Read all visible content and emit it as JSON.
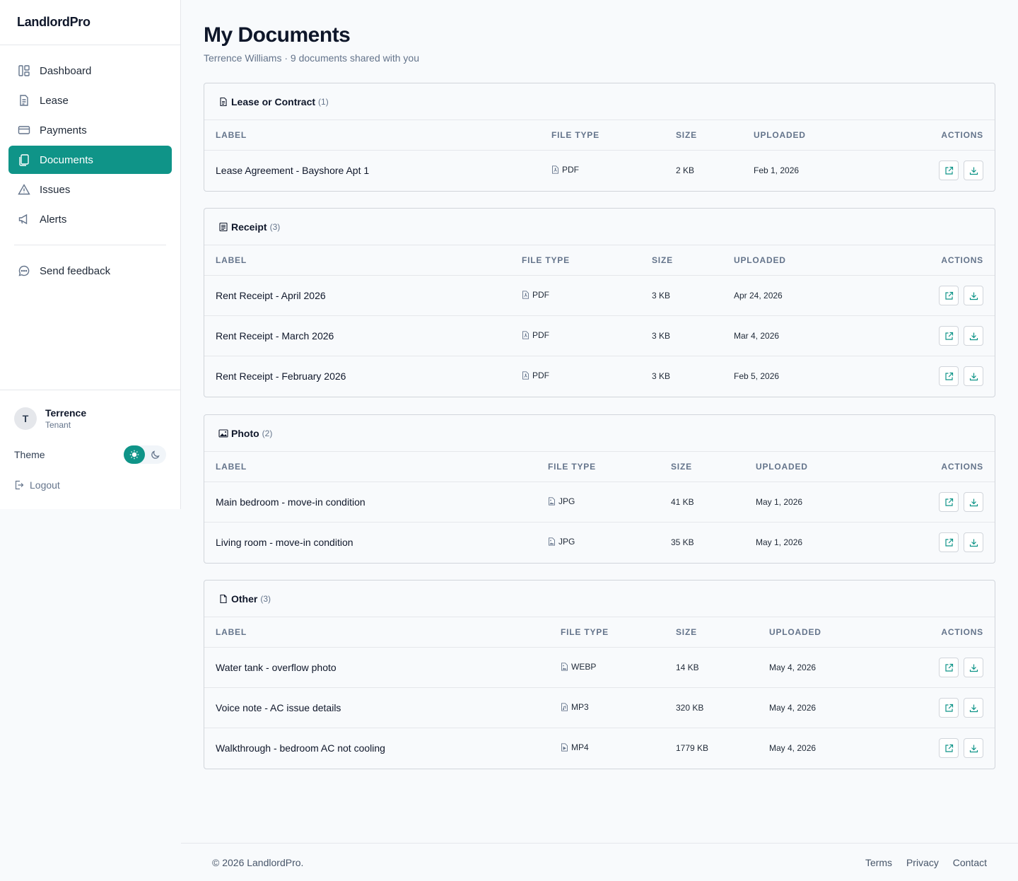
{
  "app": {
    "brand": "LandlordPro"
  },
  "sidebar": {
    "items": [
      {
        "label": "Dashboard",
        "icon": "dashboard-icon",
        "active": false
      },
      {
        "label": "Lease",
        "icon": "lease-icon",
        "active": false
      },
      {
        "label": "Payments",
        "icon": "card-icon",
        "active": false
      },
      {
        "label": "Documents",
        "icon": "documents-icon",
        "active": true
      },
      {
        "label": "Issues",
        "icon": "warning-icon",
        "active": false
      },
      {
        "label": "Alerts",
        "icon": "megaphone-icon",
        "active": false
      }
    ],
    "feedback_label": "Send feedback"
  },
  "user": {
    "initial": "T",
    "name": "Terrence",
    "role": "Tenant"
  },
  "theme": {
    "label": "Theme"
  },
  "logout_label": "Logout",
  "page": {
    "title": "My Documents",
    "subtitle": "Terrence Williams · 9 documents shared with you"
  },
  "columns": {
    "label": "LABEL",
    "file_type": "FILE TYPE",
    "size": "SIZE",
    "uploaded": "UPLOADED",
    "actions": "ACTIONS"
  },
  "sections": [
    {
      "category": "Lease or Contract",
      "count": "(1)",
      "icon": "document-icon",
      "rows": [
        {
          "label": "Lease Agreement - Bayshore Apt 1",
          "type": "PDF",
          "size": "2 KB",
          "date": "Feb 1, 2026"
        }
      ]
    },
    {
      "category": "Receipt",
      "count": "(3)",
      "icon": "receipt-icon",
      "rows": [
        {
          "label": "Rent Receipt - April 2026",
          "type": "PDF",
          "size": "3 KB",
          "date": "Apr 24, 2026"
        },
        {
          "label": "Rent Receipt - March 2026",
          "type": "PDF",
          "size": "3 KB",
          "date": "Mar 4, 2026"
        },
        {
          "label": "Rent Receipt - February 2026",
          "type": "PDF",
          "size": "3 KB",
          "date": "Feb 5, 2026"
        }
      ]
    },
    {
      "category": "Photo",
      "count": "(2)",
      "icon": "image-icon",
      "rows": [
        {
          "label": "Main bedroom - move-in condition",
          "type": "JPG",
          "size": "41 KB",
          "date": "May 1, 2026"
        },
        {
          "label": "Living room - move-in condition",
          "type": "JPG",
          "size": "35 KB",
          "date": "May 1, 2026"
        }
      ]
    },
    {
      "category": "Other",
      "count": "(3)",
      "icon": "file-icon",
      "rows": [
        {
          "label": "Water tank - overflow photo",
          "type": "WEBP",
          "size": "14 KB",
          "date": "May 4, 2026"
        },
        {
          "label": "Voice note - AC issue details",
          "type": "MP3",
          "size": "320 KB",
          "date": "May 4, 2026"
        },
        {
          "label": "Walkthrough - bedroom AC not cooling",
          "type": "MP4",
          "size": "1779 KB",
          "date": "May 4, 2026"
        }
      ]
    }
  ],
  "footer": {
    "copyright": "© 2026 LandlordPro.",
    "links": [
      "Terms",
      "Privacy",
      "Contact"
    ]
  },
  "colors": {
    "accent": "#0f9488"
  }
}
